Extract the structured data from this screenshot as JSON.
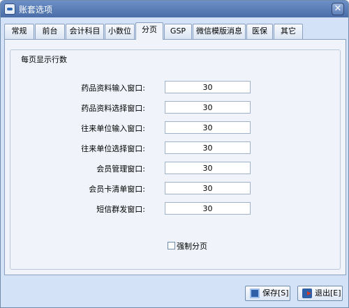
{
  "window": {
    "title": "账套选项",
    "close_symbol": "✕"
  },
  "tabs": [
    {
      "label": "常规"
    },
    {
      "label": "前台"
    },
    {
      "label": "会计科目"
    },
    {
      "label": "小数位"
    },
    {
      "label": "分页",
      "active": true
    },
    {
      "label": "GSP"
    },
    {
      "label": "微信模版消息"
    },
    {
      "label": "医保"
    },
    {
      "label": "其它"
    }
  ],
  "group": {
    "title": "每页显示行数",
    "rows": [
      {
        "label": "药品资料输入窗口:",
        "value": "30"
      },
      {
        "label": "药品资料选择窗口:",
        "value": "30"
      },
      {
        "label": "往来单位输入窗口:",
        "value": "30"
      },
      {
        "label": "往来单位选择窗口:",
        "value": "30"
      },
      {
        "label": "会员管理窗口:",
        "value": "30"
      },
      {
        "label": "会员卡清单窗口:",
        "value": "30"
      },
      {
        "label": "短信群发窗口:",
        "value": "30"
      }
    ],
    "force_paging": {
      "label": "强制分页",
      "checked": false
    }
  },
  "buttons": {
    "save_label": "保存[S]",
    "exit_label": "退出[E]"
  }
}
